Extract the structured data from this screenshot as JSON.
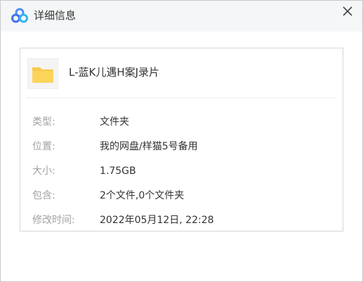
{
  "dialog": {
    "title": "详细信息",
    "close_icon": "close-icon",
    "logo_icon": "cloud-logo-icon"
  },
  "file": {
    "icon": "folder-icon",
    "name": "L-蓝K儿遇H案J录片"
  },
  "details": [
    {
      "label": "类型:",
      "value": "文件夹"
    },
    {
      "label": "位置:",
      "value": "我的网盘/样猫5号备用"
    },
    {
      "label": "大小:",
      "value": "1.75GB"
    },
    {
      "label": "包含:",
      "value": "2个文件,0个文件夹"
    },
    {
      "label": "修改时间:",
      "value": "2022年05月12日, 22:28"
    }
  ],
  "colors": {
    "title_bar": "#f5f6f7",
    "folder": "#f7c94a",
    "label": "#a2a2a2",
    "text": "#333333"
  }
}
